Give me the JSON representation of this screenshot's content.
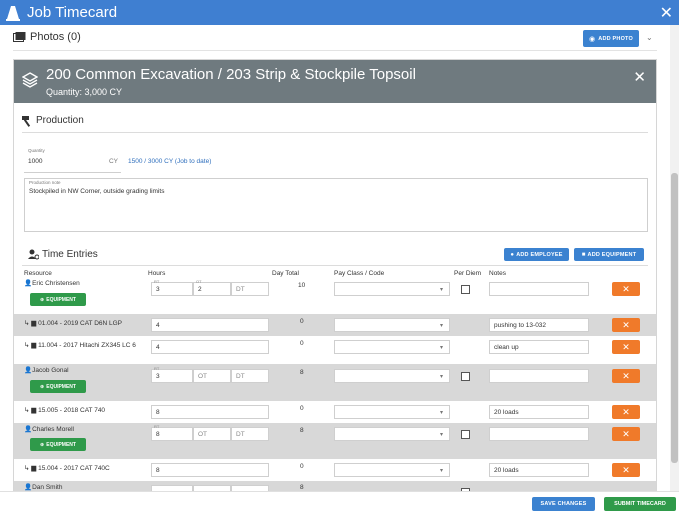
{
  "window": {
    "title": "Job Timecard"
  },
  "photos": {
    "label": "Photos (0)",
    "add_label": "ADD PHOTO"
  },
  "card": {
    "title": "200 Common Excavation / 203 Strip & Stockpile Topsoil",
    "quantity": "Quantity: 3,000 CY"
  },
  "production": {
    "title": "Production",
    "quantity_label": "Quantity",
    "quantity_value": "1000",
    "quantity_unit": "CY",
    "to_date": "1500 / 3000 CY (Job to date)",
    "notes_label": "Production note",
    "notes_value": "Stockpiled in NW Corner, outside grading limits"
  },
  "time_entries": {
    "title": "Time Entries",
    "add_employee": "ADD EMPLOYEE",
    "add_equipment": "ADD EQUIPMENT",
    "headers": [
      "Resource",
      "Hours",
      "Day Total",
      "Pay Class / Code",
      "Per Diem",
      "Notes"
    ],
    "equipment_label": "EQUIPMENT",
    "x_label": "✕",
    "rows": [
      {
        "name": "Eric Christensen",
        "reg": "3",
        "ot": "2",
        "dt": "DT",
        "total": "10",
        "note": "",
        "ot_tiny": "OT",
        "reg_tiny": "RT"
      },
      {
        "name": "01.004 - 2019 CAT D6N LGP",
        "hours": "4",
        "total": "0",
        "note": "pushing to 13-032"
      },
      {
        "name": "11.004 - 2017 Hitachi ZX345 LC 6",
        "hours": "4",
        "total": "0",
        "note": "clean up"
      },
      {
        "name": "Jacob Gonal",
        "reg": "3",
        "ot": "OT",
        "dt": "DT",
        "total": "8",
        "note": "",
        "reg_tiny": "RT"
      },
      {
        "name": "15.005 - 2018 CAT 740",
        "hours": "8",
        "total": "0",
        "note": "20 loads"
      },
      {
        "name": "Charles Morell",
        "reg": "8",
        "ot": "OT",
        "dt": "DT",
        "total": "8",
        "note": "",
        "reg_tiny": "RT"
      },
      {
        "name": "15.004 - 2017 CAT 740C",
        "hours": "8",
        "total": "0",
        "note": "20 loads"
      },
      {
        "name": "Dan Smith",
        "total": "8"
      }
    ]
  },
  "footer": {
    "save": "SAVE CHANGES",
    "submit": "SUBMIT TIMECARD"
  },
  "colors": {
    "titlebar": "#3f7fd1",
    "header": "#6f7a7f",
    "orange": "#f07a2a",
    "green": "#2f9a4a",
    "blue": "#3b82d0"
  }
}
